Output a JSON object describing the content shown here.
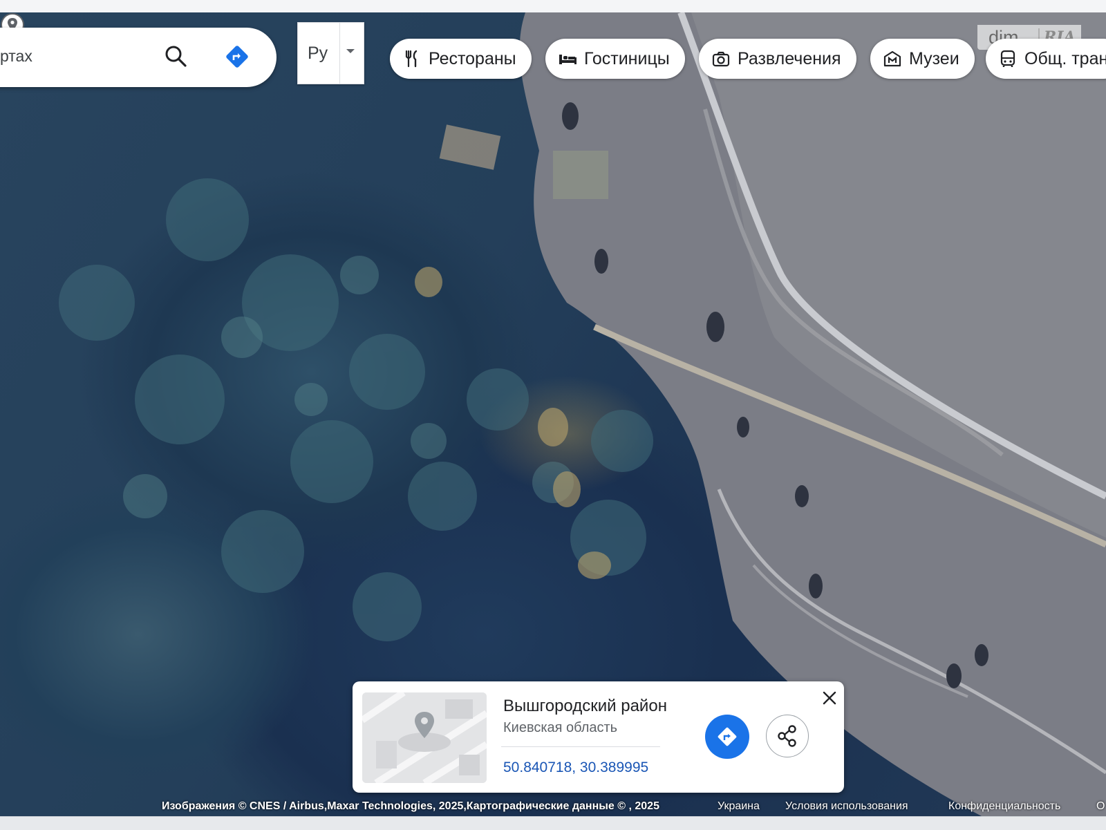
{
  "search": {
    "value": "ртах"
  },
  "language": {
    "label": "Ру"
  },
  "chips": [
    {
      "label": "Рестораны",
      "icon": "fork-knife-icon"
    },
    {
      "label": "Гостиницы",
      "icon": "bed-icon"
    },
    {
      "label": "Развлечения",
      "icon": "camera-icon"
    },
    {
      "label": "Музеи",
      "icon": "museum-icon"
    },
    {
      "label": "Общ. тран",
      "icon": "bus-icon"
    }
  ],
  "watermark": {
    "text": "dim",
    "brand": "RIA"
  },
  "place_card": {
    "title": "Вышгородский район",
    "subtitle": "Киевская область",
    "coordinates": "50.840718, 30.389995"
  },
  "footer": {
    "imagery": "Изображения © CNES / Airbus,Maxar Technologies, 2025,Картографические данные © , 2025",
    "country": "Украина",
    "terms": "Условия использования",
    "privacy": "Конфиденциальность",
    "more": "О"
  },
  "colors": {
    "accent": "#1a73e8",
    "link": "#1a56b5"
  }
}
